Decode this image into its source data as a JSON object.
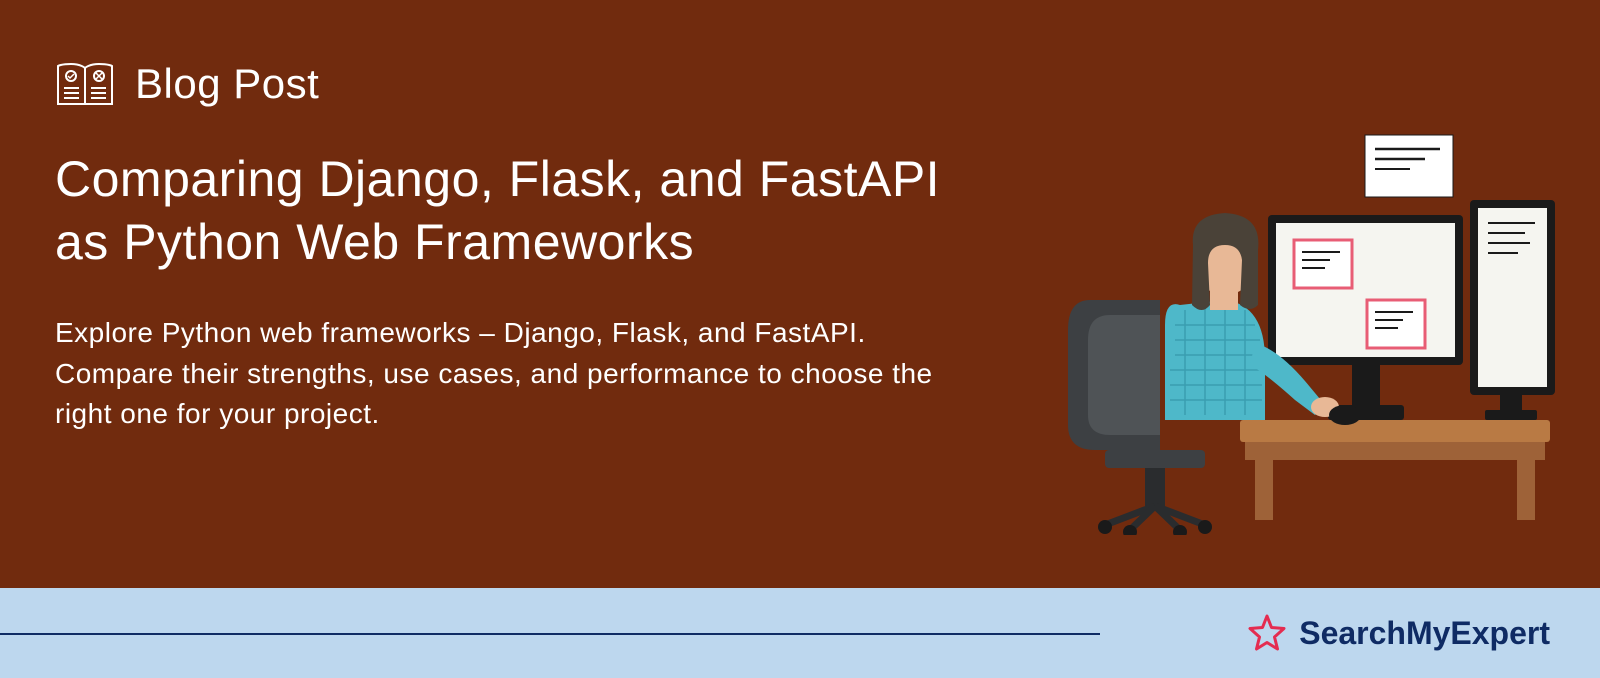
{
  "category": "Blog Post",
  "title": "Comparing Django, Flask, and FastAPI as Python Web Frameworks",
  "description": "Explore Python web frameworks – Django, Flask, and FastAPI. Compare their strengths, use cases, and performance to choose the right one for your project.",
  "brand": "SearchMyExpert"
}
